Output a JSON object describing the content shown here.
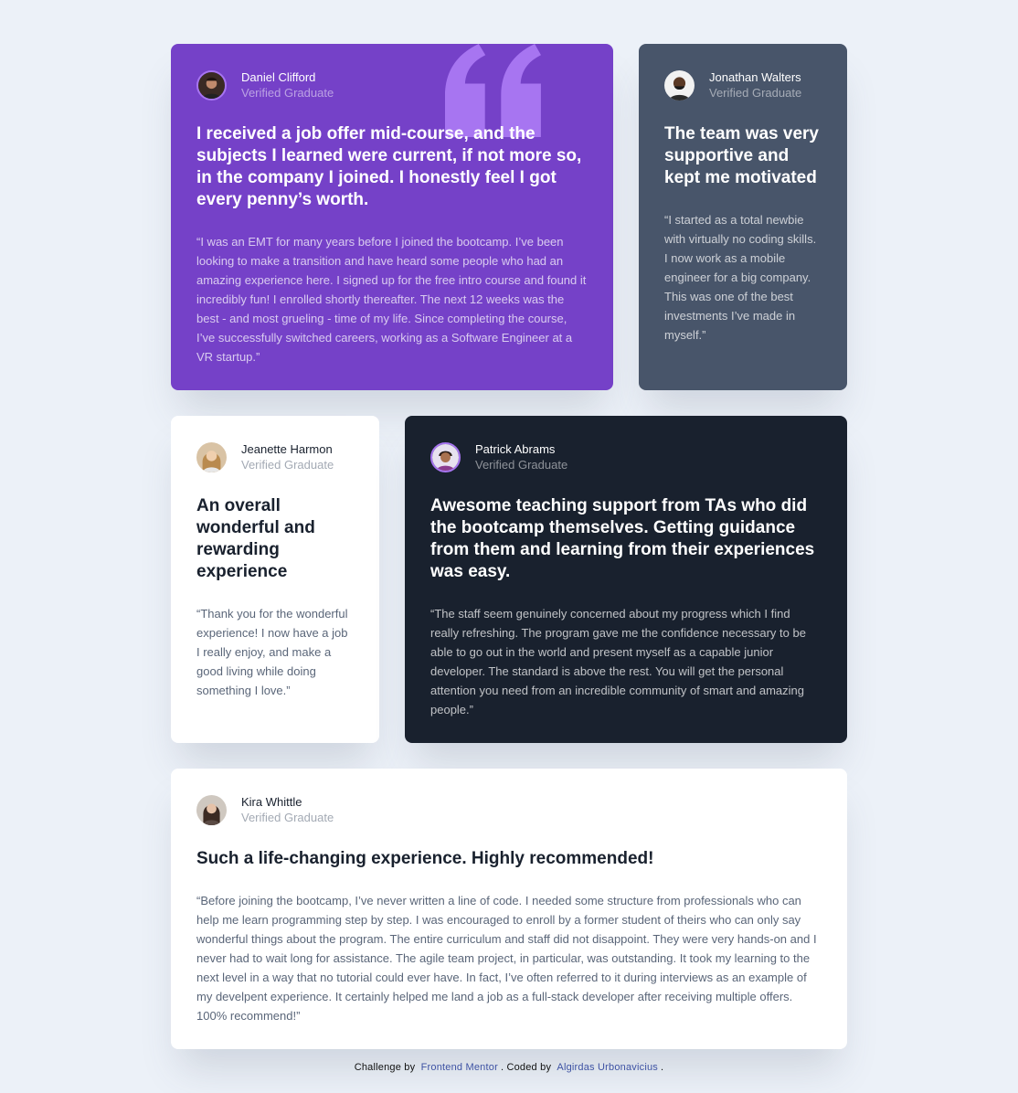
{
  "colors": {
    "background": "#ecf1f8",
    "purple": "#7541c8",
    "grayish_blue": "#48556a",
    "dark_blue": "#19212e",
    "white": "#ffffff",
    "quote_mark": "#a775f1",
    "link": "#3e52a3"
  },
  "testimonials": [
    {
      "name": "Daniel Clifford",
      "role": "Verified Graduate",
      "avatar_icon": "avatar-daniel-icon",
      "headline": "I received a job offer mid-course, and the subjects I learned were current, if not more so, in the company I joined. I honestly feel I got every penny’s worth.",
      "quote": "“I was an EMT for many years before I joined the bootcamp. I’ve been looking to make a transition and have heard some people who had an amazing experience here. I signed up for the free intro course and found it incredibly fun! I enrolled shortly thereafter. The next 12 weeks was the best - and most grueling - time of my life. Since completing the course, I’ve successfully switched careers, working as a Software Engineer at a VR startup.”"
    },
    {
      "name": "Jonathan Walters",
      "role": "Verified Graduate",
      "avatar_icon": "avatar-jonathan-icon",
      "headline": "The team was very supportive and kept me motivated",
      "quote": "“I started as a total newbie with virtually no coding skills. I now work as a mobile engineer for a big company. This was one of the best investments I’ve made in myself.”"
    },
    {
      "name": "Jeanette Harmon",
      "role": "Verified Graduate",
      "avatar_icon": "avatar-jeanette-icon",
      "headline": "An overall wonderful and rewarding experience",
      "quote": "“Thank you for the wonderful experience! I now have a job I really enjoy, and make a good living while doing something I love.”"
    },
    {
      "name": "Patrick Abrams",
      "role": "Verified Graduate",
      "avatar_icon": "avatar-patrick-icon",
      "headline": "Awesome teaching support from TAs who did the bootcamp themselves. Getting guidance from them and learning from their experiences was easy.",
      "quote": "“The staff seem genuinely concerned about my progress which I find really refreshing. The program gave me the confidence necessary to be able to go out in the world and present myself as a capable junior developer. The standard is above the rest. You will get the personal attention you need from an incredible community of smart and amazing people.”"
    },
    {
      "name": "Kira Whittle",
      "role": "Verified Graduate",
      "avatar_icon": "avatar-kira-icon",
      "headline": "Such a life-changing experience. Highly recommended!",
      "quote": "“Before joining the bootcamp, I’ve never written a line of code. I needed some structure from professionals who can help me learn programming step by step. I was encouraged to enroll by a former student of theirs who can only say wonderful things about the program. The entire curriculum and staff did not disappoint. They were very hands-on and I never had to wait long for assistance. The agile team project, in particular, was outstanding. It took my learning to the next level in a way that no tutorial could ever have. In fact, I’ve often referred to it during interviews as an example of my develpent experience. It certainly helped me land a job as a full-stack developer after receiving multiple offers. 100% recommend!”"
    }
  ],
  "footer": {
    "prefix": "Challenge by",
    "link1": "Frontend Mentor",
    "middle": ". Coded by",
    "link2": "Algirdas Urbonavicius",
    "suffix": "."
  }
}
